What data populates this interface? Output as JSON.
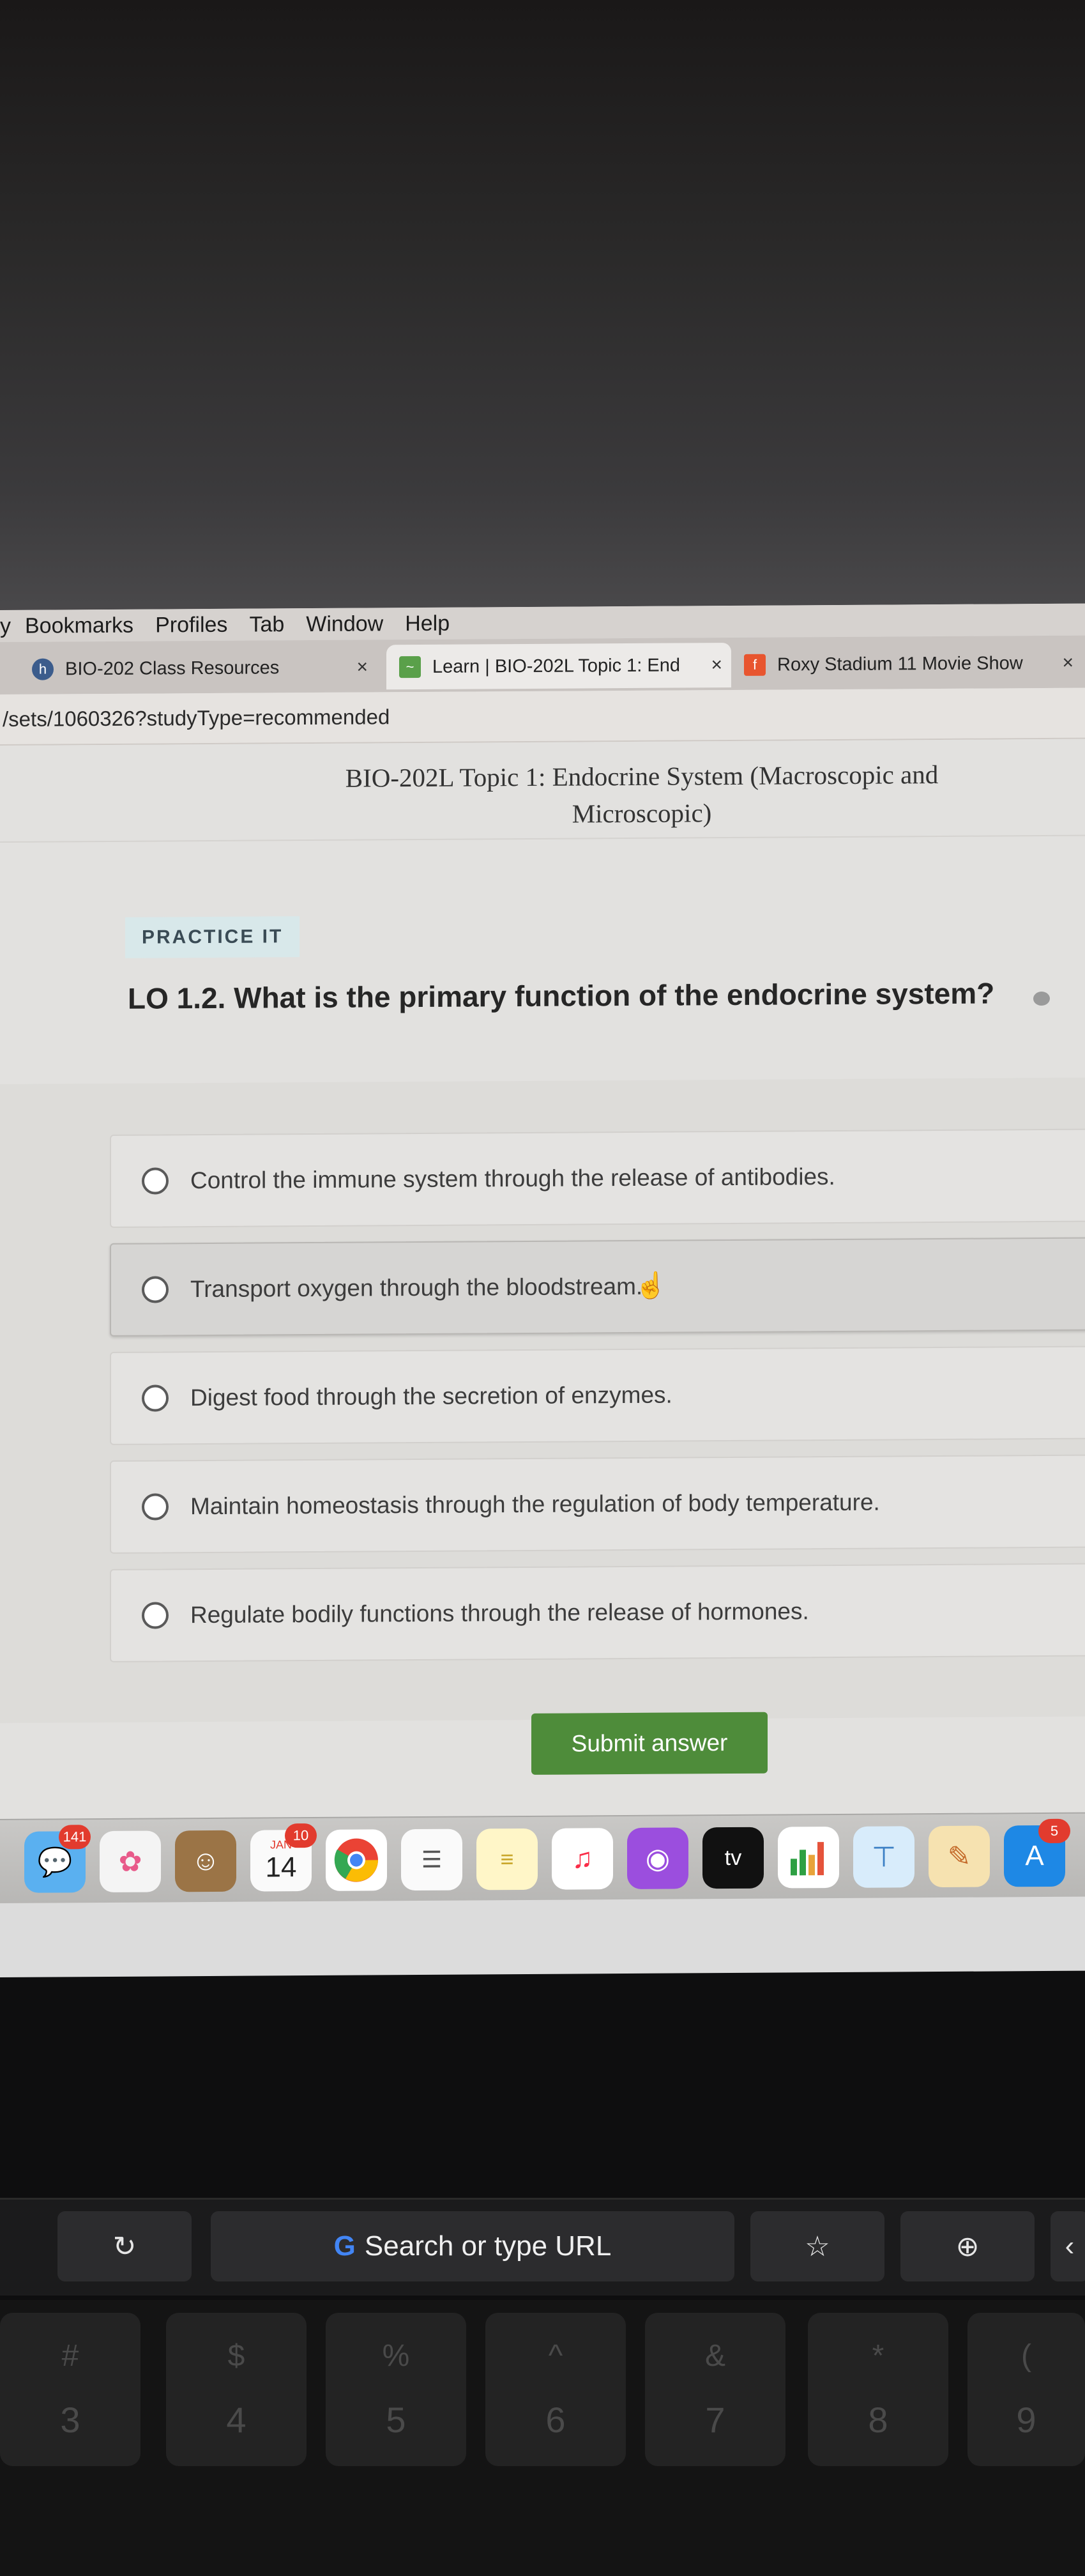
{
  "menubar": {
    "lead": "y",
    "items": [
      "Bookmarks",
      "Profiles",
      "Tab",
      "Window",
      "Help"
    ]
  },
  "tabs": [
    {
      "icon": "h",
      "label": "BIO-202 Class Resources",
      "close": "×"
    },
    {
      "icon": "~",
      "label": "Learn | BIO-202L Topic 1: End",
      "close": "×"
    },
    {
      "icon": "f",
      "label": "Roxy Stadium 11 Movie Show",
      "close": "×"
    }
  ],
  "address": {
    "url": "/sets/1060326?studyType=recommended"
  },
  "page": {
    "set_title": "BIO-202L Topic 1: Endocrine System (Macroscopic and Microscopic)",
    "badge": "PRACTICE IT",
    "question": "LO 1.2. What is the primary function of the endocrine system?",
    "options": [
      "Control the immune system through the release of antibodies.",
      "Transport oxygen through the bloodstream.",
      "Digest food through the secretion of enzymes.",
      "Maintain homeostasis through the regulation of body temperature.",
      "Regulate bodily functions through the release of hormones."
    ],
    "submit_label": "Submit answer"
  },
  "dock": {
    "messages_badge": "141",
    "calendar_month": "JAN",
    "calendar_day": "14",
    "calendar_badge": "10",
    "tv_label": "tv",
    "appstore_badge": "5",
    "colors": {
      "messages": "#34c759",
      "chrome": "#ea4335",
      "music": "#fa2d48",
      "podcasts": "#9b4ede",
      "appstore": "#1e88e5"
    }
  },
  "touchbar": {
    "search_text": "Search or type URL"
  },
  "keys": [
    {
      "sym": "#",
      "num": "3"
    },
    {
      "sym": "$",
      "num": "4"
    },
    {
      "sym": "%",
      "num": "5"
    },
    {
      "sym": "^",
      "num": "6"
    },
    {
      "sym": "&",
      "num": "7"
    },
    {
      "sym": "*",
      "num": "8"
    },
    {
      "sym": "(",
      "num": "9"
    }
  ]
}
